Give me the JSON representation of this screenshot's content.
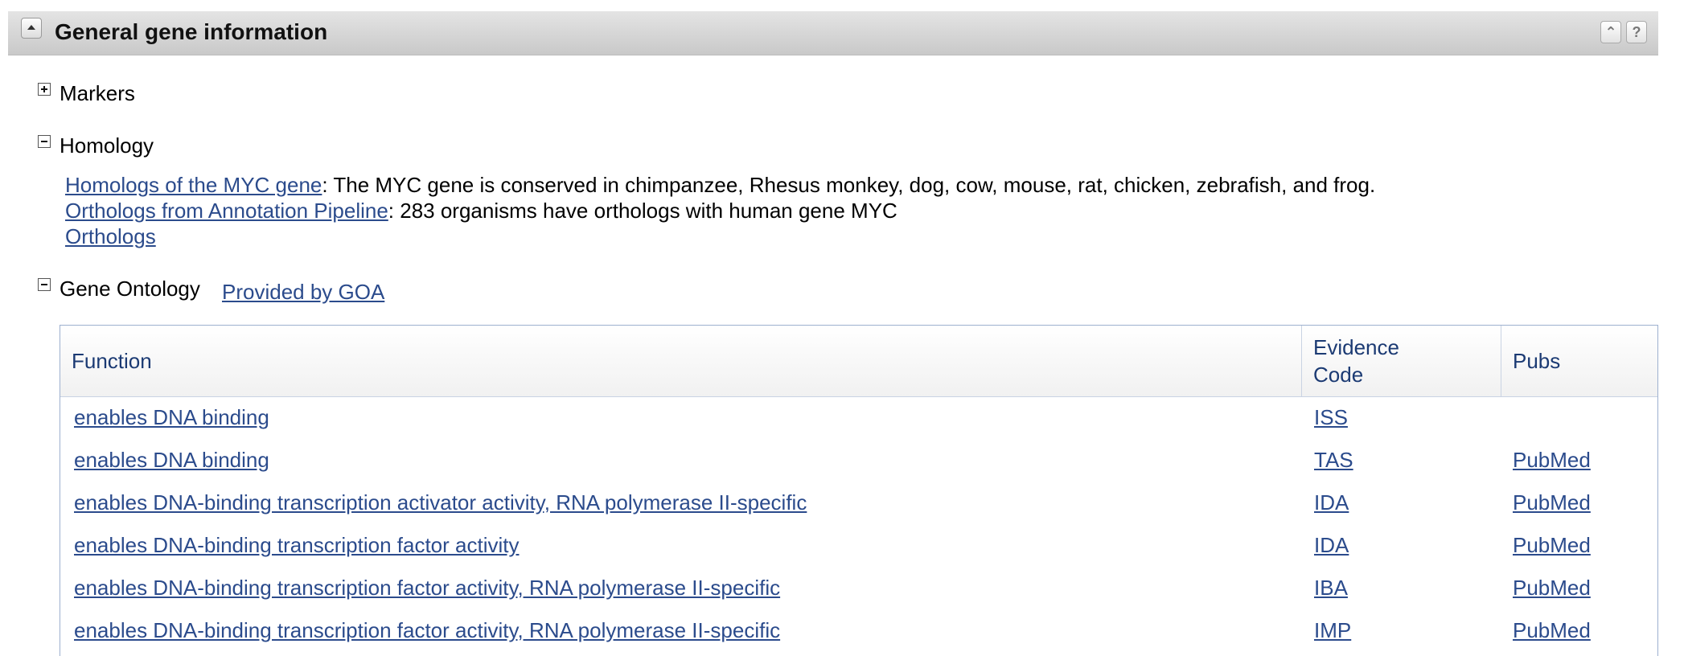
{
  "header": {
    "title": "General gene information",
    "collapse_label": "",
    "up_icon": "double-chevron-up-icon",
    "help_icon": "help-icon",
    "help_glyph": "?",
    "up_glyph": "⌃"
  },
  "markers": {
    "label": "Markers",
    "state": "collapsed"
  },
  "homology": {
    "label": "Homology",
    "state": "expanded",
    "homologs_link": "Homologs of the MYC gene",
    "homologs_text": ": The MYC gene is conserved in chimpanzee, Rhesus monkey, dog, cow, mouse, rat, chicken, zebrafish, and frog.",
    "orthologs_pipeline_link": "Orthologs from Annotation Pipeline",
    "orthologs_pipeline_text": ": 283 organisms have orthologs with human gene MYC",
    "orthologs_link": "Orthologs"
  },
  "gene_ontology": {
    "label": "Gene Ontology",
    "state": "expanded",
    "provider_link": "Provided by GOA",
    "columns": {
      "function": "Function",
      "evidence": "Evidence Code",
      "pubs": "Pubs"
    },
    "rows": [
      {
        "function": "enables DNA binding",
        "evidence": "ISS",
        "pubs": ""
      },
      {
        "function": "enables DNA binding",
        "evidence": "TAS",
        "pubs": "PubMed"
      },
      {
        "function": "enables DNA-binding transcription activator activity, RNA polymerase II-specific",
        "evidence": "IDA",
        "pubs": "PubMed"
      },
      {
        "function": "enables DNA-binding transcription factor activity",
        "evidence": "IDA",
        "pubs": "PubMed"
      },
      {
        "function": "enables DNA-binding transcription factor activity, RNA polymerase II-specific",
        "evidence": "IBA",
        "pubs": "PubMed"
      },
      {
        "function": "enables DNA-binding transcription factor activity, RNA polymerase II-specific",
        "evidence": "IMP",
        "pubs": "PubMed"
      }
    ]
  },
  "colors": {
    "link": "#2b4b8c",
    "header_text": "#1b3a73",
    "table_border": "#9db0cf"
  }
}
